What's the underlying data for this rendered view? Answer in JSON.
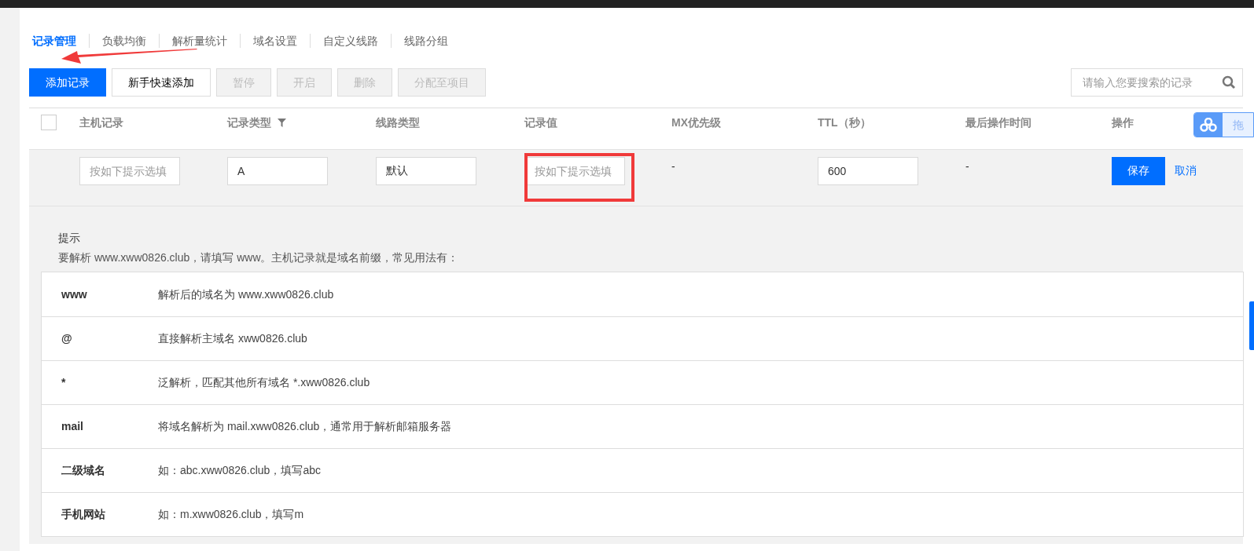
{
  "tabs": [
    {
      "label": "记录管理",
      "selected": true
    },
    {
      "label": "负载均衡",
      "selected": false
    },
    {
      "label": "解析量统计",
      "selected": false
    },
    {
      "label": "域名设置",
      "selected": false
    },
    {
      "label": "自定义线路",
      "selected": false
    },
    {
      "label": "线路分组",
      "selected": false
    }
  ],
  "toolbar": [
    {
      "label": "添加记录",
      "kind": "primary",
      "disabled": false
    },
    {
      "label": "新手快速添加",
      "kind": "default",
      "disabled": false
    },
    {
      "label": "暂停",
      "kind": "default",
      "disabled": true
    },
    {
      "label": "开启",
      "kind": "default",
      "disabled": true
    },
    {
      "label": "删除",
      "kind": "default",
      "disabled": true
    },
    {
      "label": "分配至项目",
      "kind": "default",
      "disabled": true
    }
  ],
  "search": {
    "placeholder": "请输入您要搜索的记录"
  },
  "table": {
    "select_all": {
      "checked": false
    },
    "columns": [
      {
        "label": "主机记录",
        "filter": false
      },
      {
        "label": "记录类型",
        "filter": true
      },
      {
        "label": "线路类型",
        "filter": false
      },
      {
        "label": "记录值",
        "filter": false
      },
      {
        "label": "MX优先级",
        "filter": false
      },
      {
        "label": "TTL（秒）",
        "filter": false
      },
      {
        "label": "最后操作时间",
        "filter": false
      },
      {
        "label": "操作",
        "filter": false
      }
    ],
    "edit_row": {
      "host": {
        "placeholder": "按如下提示选填"
      },
      "type": {
        "value": "A"
      },
      "line": {
        "value": "默认"
      },
      "value": {
        "placeholder": "按如下提示选填"
      },
      "mx": "-",
      "ttl": {
        "value": "600"
      },
      "last_op": "-",
      "save": "保存",
      "cancel": "取消"
    }
  },
  "floating_widget": {
    "label": "拖"
  },
  "hint": {
    "title": "提示",
    "text": "要解析 www.xww0826.club，请填写 www。主机记录就是域名前缀，常见用法有：",
    "examples": [
      {
        "key": "www",
        "desc": "解析后的域名为 www.xww0826.club"
      },
      {
        "key": "@",
        "desc": "直接解析主域名 xww0826.club"
      },
      {
        "key": "*",
        "desc": "泛解析，匹配其他所有域名 *.xww0826.club"
      },
      {
        "key": "mail",
        "desc": "将域名解析为 mail.xww0826.club，通常用于解析邮箱服务器"
      },
      {
        "key": "二级域名",
        "desc": "如：abc.xww0826.club，填写abc"
      },
      {
        "key": "手机网站",
        "desc": "如：m.xww0826.club，填写m"
      }
    ]
  }
}
